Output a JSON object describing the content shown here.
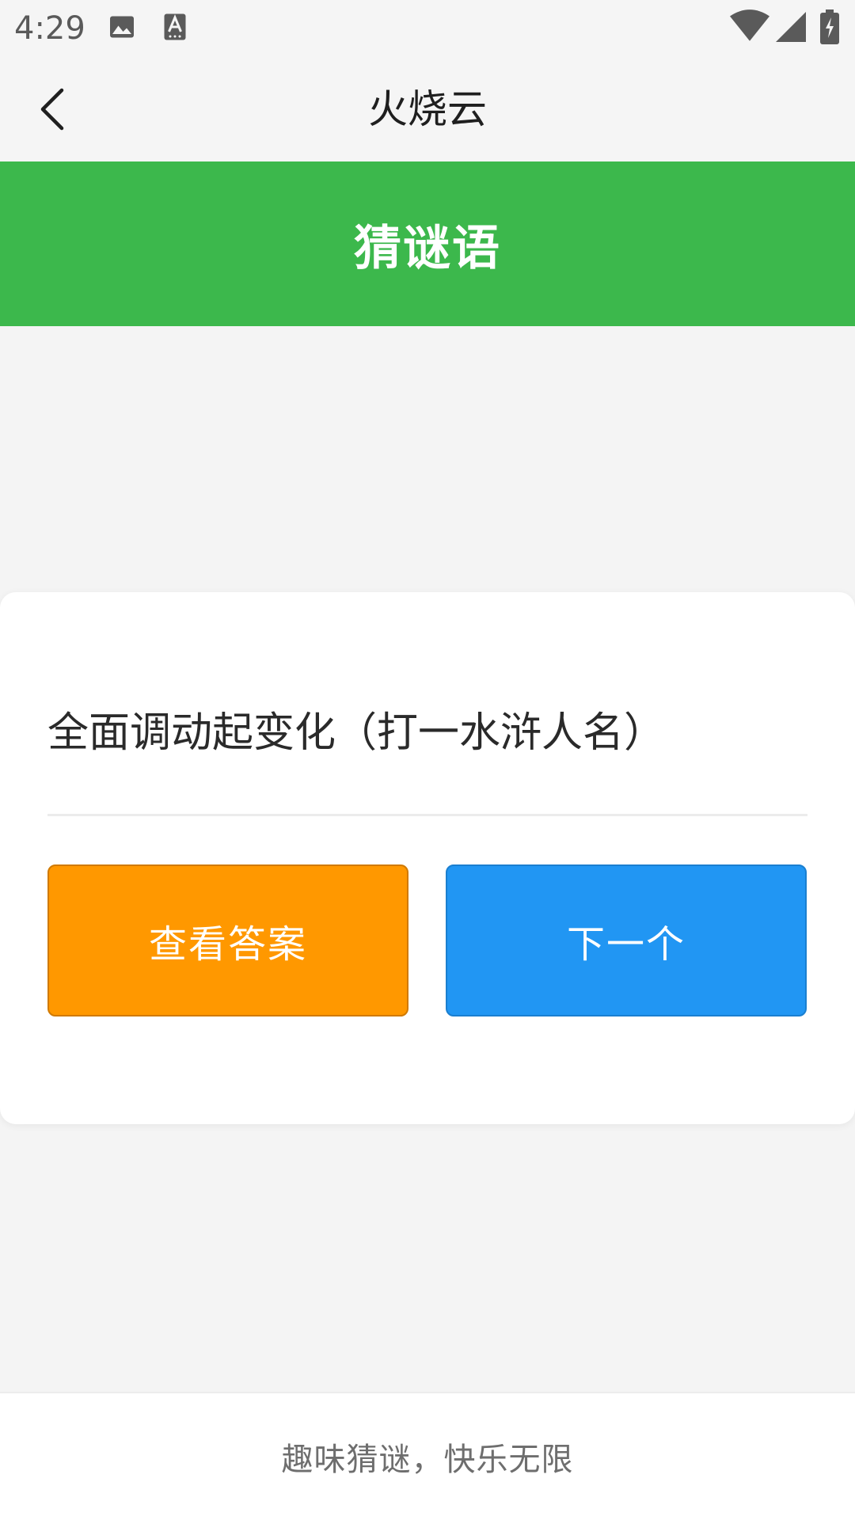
{
  "status_bar": {
    "time": "4:29",
    "icons": [
      "image-icon",
      "text-a-icon",
      "wifi-icon",
      "signal-icon",
      "battery-charging-icon"
    ]
  },
  "app_bar": {
    "title": "火烧云",
    "back_icon": "chevron-left-icon"
  },
  "header": {
    "title": "猜谜语"
  },
  "riddle": {
    "question": "全面调动起变化（打一水浒人名）"
  },
  "buttons": {
    "show_answer": "查看答案",
    "next": "下一个"
  },
  "footer": {
    "slogan": "趣味猜谜，快乐无限"
  },
  "colors": {
    "header_green": "#3cb84c",
    "answer_orange": "#ff9800",
    "next_blue": "#2196f3"
  }
}
